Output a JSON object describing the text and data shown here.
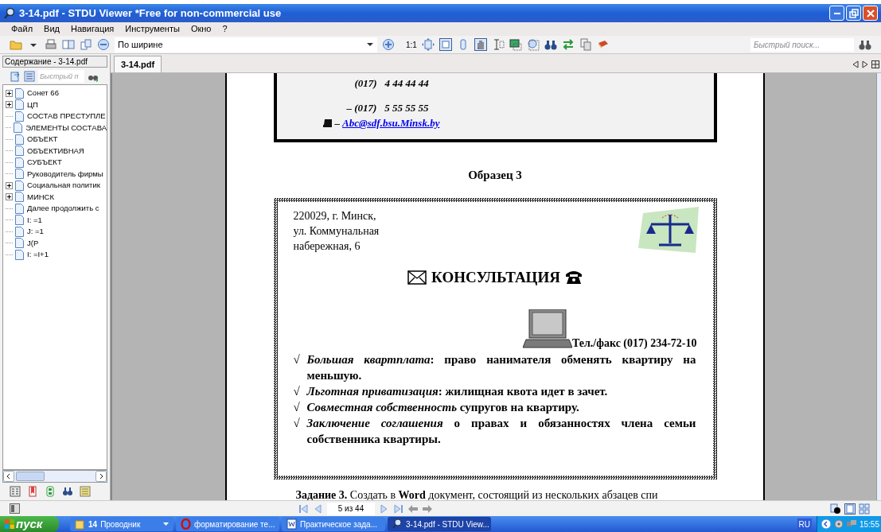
{
  "window": {
    "title": "3-14.pdf - STDU Viewer *Free for non-commercial use"
  },
  "menu": [
    "Файл",
    "Вид",
    "Навигация",
    "Инструменты",
    "Окно",
    "?"
  ],
  "toolbar": {
    "zoom_mode": "По ширине",
    "actual_size": "1:1",
    "quick_search": {
      "placeholder": "Быстрый поиск..."
    }
  },
  "sidebar": {
    "title": "Содержание - 3-14.pdf",
    "search": {
      "placeholder": "Быстрый п"
    },
    "items": [
      {
        "label": "Сонет 66",
        "kind": "collapsed"
      },
      {
        "label": "ЦП",
        "kind": "collapsed"
      },
      {
        "label": "СОСТАВ  ПРЕСТУПЛЕ",
        "kind": "leaf"
      },
      {
        "label": "ЭЛЕМЕНТЫ СОСТАВА",
        "kind": "leaf"
      },
      {
        "label": "ОБЪЕКТ",
        "kind": "leaf"
      },
      {
        "label": "ОБЪЕКТИВНАЯ",
        "kind": "leaf"
      },
      {
        "label": "СУБЪЕКТ",
        "kind": "leaf"
      },
      {
        "label": "Руководитель фирмы",
        "kind": "leaf"
      },
      {
        "label": "Социальная политик",
        "kind": "collapsed"
      },
      {
        "label": "МИНСК",
        "kind": "collapsed"
      },
      {
        "label": "Далее продолжить с",
        "kind": "leaf"
      },
      {
        "label": "I: =1",
        "kind": "leaf"
      },
      {
        "label": "J: =1",
        "kind": "leaf"
      },
      {
        "label": "J(P",
        "kind": "leaf"
      },
      {
        "label": "I: =I+1",
        "kind": "leaf"
      }
    ]
  },
  "tabs": [
    {
      "label": "3-14.pdf",
      "selected": true
    }
  ],
  "document": {
    "phones": [
      "(017)   4 44 44 44",
      "– (017)   5 55 55 55"
    ],
    "email_dash": "–",
    "email": "Abc@sdf.bsu.Minsk.by",
    "sample_title": "Образец 3",
    "address": [
      "220029, г. Минск,",
      "ул. Коммунальная",
      "набережная, 6"
    ],
    "heading": "КОНСУЛЬТАЦИЯ",
    "tel": "Тел./факс (017) 234-72-10",
    "bullets": [
      {
        "mark": "√",
        "text": "*Большая квартплата*: право нанимателя обменять квартиру на меньшую."
      },
      {
        "mark": "√",
        "text": "*Льготная приватизация*: жилищная квота идет в зачет."
      },
      {
        "mark": "√",
        "text": "*Совместная собственность* супругов на квартиру."
      },
      {
        "mark": "√",
        "text": "*Заключение соглашения* о правах и обязанностях члена семьи собственника квартиры."
      }
    ],
    "task": "**Задание 3.** Создать в **Word** документ, состоящий из нескольких абзацев спи"
  },
  "page_nav": "5 из 44",
  "taskbar": {
    "start": "пуск",
    "tasks": [
      {
        "count": "14",
        "label": "Проводник",
        "kind": "folder",
        "selected": false
      },
      {
        "label": "форматирование те...",
        "kind": "browser",
        "selected": false
      },
      {
        "label": "Практическое зада...",
        "kind": "word",
        "selected": false
      },
      {
        "label": "3-14.pdf - STDU View...",
        "kind": "viewer",
        "selected": true
      }
    ],
    "language": "RU",
    "clock": "15:55"
  }
}
